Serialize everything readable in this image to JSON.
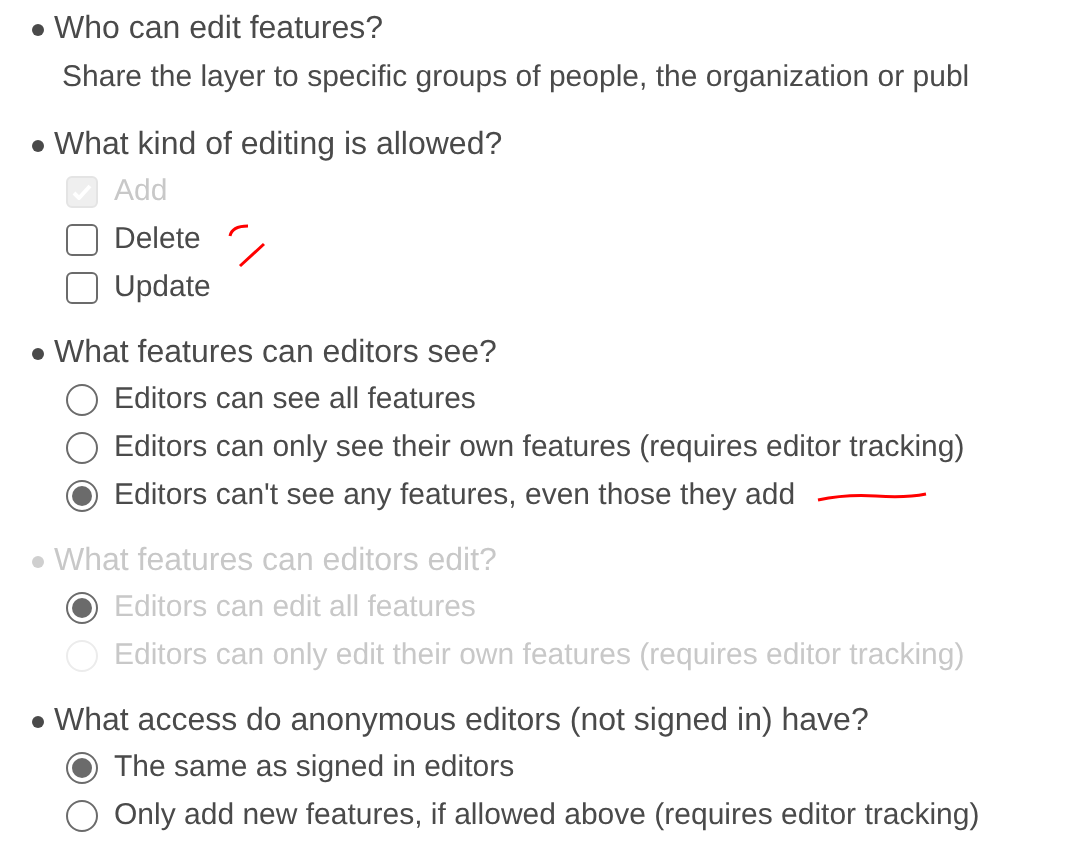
{
  "sections": [
    {
      "heading": "Who can edit features?",
      "disabled": false,
      "text": "Share the layer to specific groups of people, the organization or publ"
    },
    {
      "heading": "What kind of editing is allowed?",
      "disabled": false,
      "options": [
        {
          "kind": "checkbox",
          "label": "Add",
          "checked": true,
          "disabled": true
        },
        {
          "kind": "checkbox",
          "label": "Delete",
          "checked": false,
          "disabled": false
        },
        {
          "kind": "checkbox",
          "label": "Update",
          "checked": false,
          "disabled": false
        }
      ]
    },
    {
      "heading": "What features can editors see?",
      "disabled": false,
      "options": [
        {
          "kind": "radio",
          "label": "Editors can see all features",
          "selected": false,
          "disabled": false
        },
        {
          "kind": "radio",
          "label": "Editors can only see their own features (requires editor tracking)",
          "selected": false,
          "disabled": false
        },
        {
          "kind": "radio",
          "label": "Editors can't see any features, even those they add",
          "selected": true,
          "disabled": false
        }
      ]
    },
    {
      "heading": "What features can editors edit?",
      "disabled": true,
      "options": [
        {
          "kind": "radio",
          "label": "Editors can edit all features",
          "selected": true,
          "disabled": true
        },
        {
          "kind": "radio",
          "label": "Editors can only edit their own features (requires editor tracking)",
          "selected": false,
          "disabled": true
        }
      ]
    },
    {
      "heading": "What access do anonymous editors (not signed in) have?",
      "disabled": false,
      "options": [
        {
          "kind": "radio",
          "label": "The same as signed in editors",
          "selected": true,
          "disabled": false
        },
        {
          "kind": "radio",
          "label": "Only add new features, if allowed above (requires editor tracking)",
          "selected": false,
          "disabled": false
        }
      ]
    }
  ]
}
